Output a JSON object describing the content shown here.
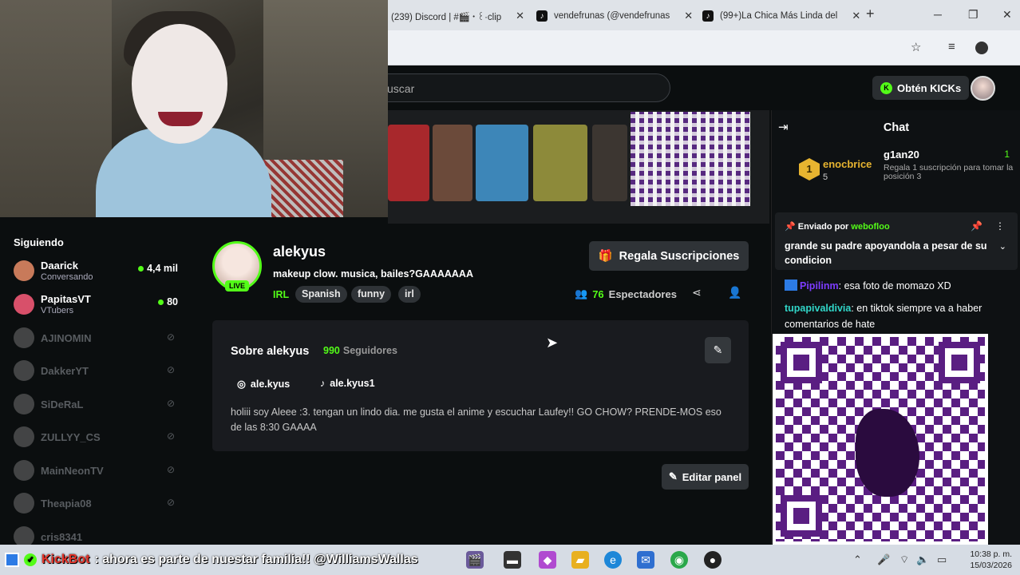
{
  "browser": {
    "tabs": [
      {
        "label": "(239) Discord | #🎬・꒰·clip"
      },
      {
        "label": "vendefrunas (@vendefrunas"
      },
      {
        "label": "(99+)La Chica Más Linda del"
      }
    ],
    "new_tab": "+",
    "minimize": "─",
    "maximize": "❐",
    "close": "✕"
  },
  "header": {
    "search_placeholder": "uscar",
    "kicks_label": "Obtén KICKs"
  },
  "sidebar": {
    "heading": "Siguiendo",
    "live": [
      {
        "name": "Daarick",
        "sub": "Conversando",
        "count": "4,4 mil"
      },
      {
        "name": "PapitasVT",
        "sub": "VTubers",
        "count": "80"
      }
    ],
    "offline": [
      "AJINOMIN",
      "DakkerYT",
      "SiDeRaL",
      "ZULLYY_CS",
      "MainNeonTV",
      "Theapia08",
      "cris8341"
    ]
  },
  "channel": {
    "name": "alekyus",
    "live_badge": "LIVE",
    "title": "makeup clow. musica, bailes?GAAAAAAA",
    "category": "IRL",
    "tags": [
      "Spanish",
      "funny",
      "irl"
    ],
    "gift_label": "Regala Suscripciones",
    "viewers_count": "76",
    "viewers_label": "Espectadores"
  },
  "about": {
    "heading": "Sobre alekyus",
    "followers_count": "990",
    "followers_label": "Seguidores",
    "instagram": "ale.kyus",
    "tiktok": "ale.kyus1",
    "bio": "holiii soy Aleee :3. tengan un lindo dia. me gusta el anime y escuchar Laufey!! GO CHOW? PRENDE-MOS eso de las 8:30 GAAAA",
    "edit_panel": "Editar panel"
  },
  "chat": {
    "title": "Chat",
    "leader_rank": "1",
    "leader_user": "enocbrice",
    "leader_score": "5",
    "second_user": "g1an20",
    "second_desc": "Regala 1 suscripción para tomar la posición 3",
    "second_score": "1",
    "pinned_prefix": "Enviado por",
    "pinned_user": "webofloo",
    "pinned_msg": "grande su padre apoyandola a pesar de su condicion",
    "messages": [
      {
        "user": "Pipilinm",
        "text": ": esa foto de momazo XD"
      },
      {
        "user": "tupapivaldivia",
        "text": ": en tiktok siempre va a haber comentarios de hate"
      }
    ]
  },
  "taskbar": {
    "kickbot_name": "KickBot",
    "kickbot_msg": ": ahora es parte de nuestar familia!! @WilliamsWallas",
    "time": "10:38 p. m.",
    "date": "15/03/2026"
  }
}
